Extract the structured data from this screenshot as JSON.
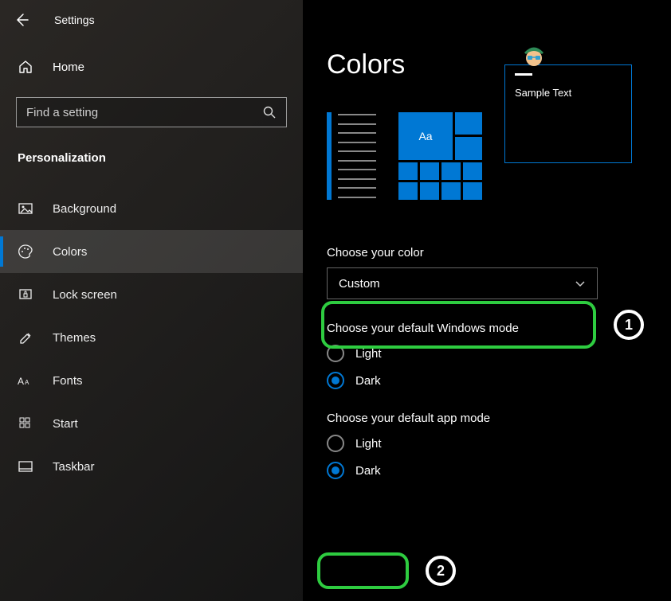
{
  "window_title": "Settings",
  "home_label": "Home",
  "search_placeholder": "Find a setting",
  "category": "Personalization",
  "nav": [
    {
      "label": "Background"
    },
    {
      "label": "Colors"
    },
    {
      "label": "Lock screen"
    },
    {
      "label": "Themes"
    },
    {
      "label": "Fonts"
    },
    {
      "label": "Start"
    },
    {
      "label": "Taskbar"
    }
  ],
  "page_title": "Colors",
  "sample_text": "Sample Text",
  "tile_text": "Aa",
  "choose_color": {
    "label": "Choose your color",
    "value": "Custom"
  },
  "windows_mode": {
    "label": "Choose your default Windows mode",
    "options": {
      "light": "Light",
      "dark": "Dark"
    },
    "selected": "dark"
  },
  "app_mode": {
    "label": "Choose your default app mode",
    "options": {
      "light": "Light",
      "dark": "Dark"
    },
    "selected": "dark"
  },
  "callouts": {
    "one": "1",
    "two": "2"
  },
  "accent_color": "#0078d4"
}
